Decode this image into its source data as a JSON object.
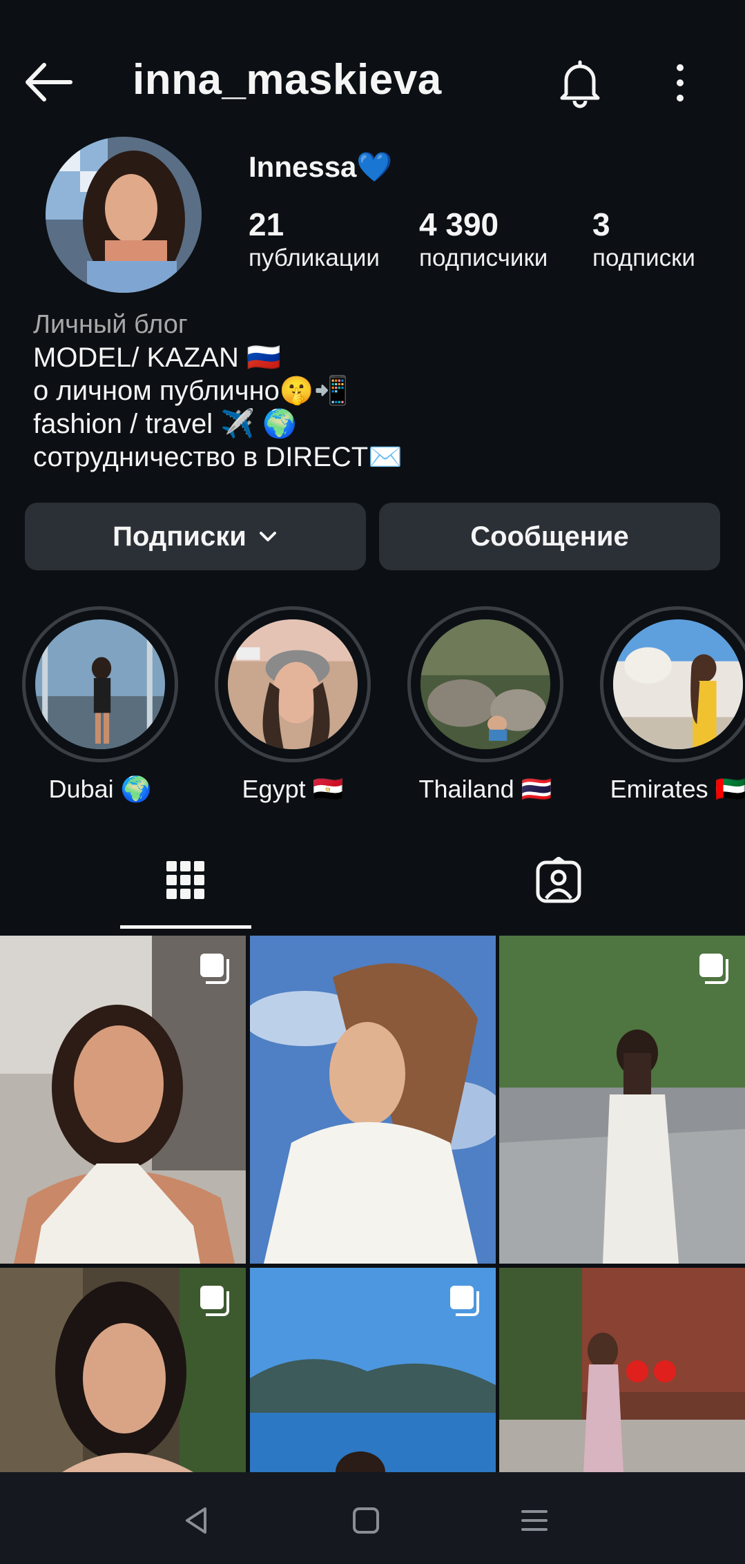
{
  "header": {
    "username": "inna_maskieva"
  },
  "profile": {
    "display_name": "Innessa💙",
    "stats": [
      {
        "value": "21",
        "label": "публикации"
      },
      {
        "value": "4 390",
        "label": "подписчики"
      },
      {
        "value": "3",
        "label": "подписки"
      }
    ],
    "bio": {
      "category": "Личный блог",
      "lines": [
        "MODEL/ KAZAN 🇷🇺",
        "о личном публично🤫📲",
        "fashion / travel ✈️ 🌍",
        "сотрудничество в DIRECT✉️"
      ]
    }
  },
  "actions": {
    "following_label": "Подписки",
    "message_label": "Сообщение"
  },
  "highlights": [
    {
      "label": "Dubai 🌍"
    },
    {
      "label": "Egypt 🇪🇬"
    },
    {
      "label": "Thailand 🇹🇭"
    },
    {
      "label": "Emirates 🇦🇪"
    }
  ],
  "tabs": {
    "active": "grid",
    "icons": [
      "grid-icon",
      "tagged-icon"
    ]
  },
  "posts": [
    {
      "multi": true
    },
    {
      "multi": false
    },
    {
      "multi": true
    },
    {
      "multi": true
    },
    {
      "multi": true
    },
    {
      "multi": false
    }
  ],
  "colors": {
    "background": "#0c1014",
    "button": "#2b3036",
    "secondary_text": "#a8a8a8"
  }
}
